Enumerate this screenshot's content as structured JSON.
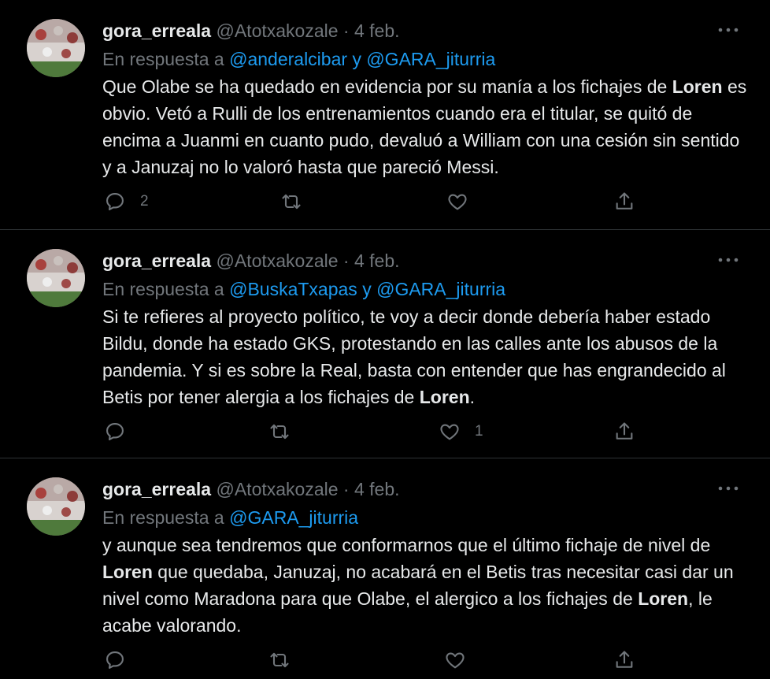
{
  "colors": {
    "background": "#000000",
    "text": "#e7e9ea",
    "secondary": "#71767b",
    "link": "#1d9bf0",
    "divider": "#2f3336"
  },
  "tweets": [
    {
      "display_name": "gora_erreala",
      "handle": "@Atotxakozale",
      "separator": "·",
      "date": "4 feb.",
      "reply_prefix": "En respuesta a",
      "reply_mentions": [
        "@anderalcibar",
        "@GARA_jiturria"
      ],
      "reply_conjunction": "y",
      "text": [
        {
          "t": "Que Olabe se ha quedado en evidencia por su manía a los fichajes de ",
          "b": false
        },
        {
          "t": "Loren",
          "b": true
        },
        {
          "t": " es obvio. Vetó a Rulli de los entrenamientos cuando era el titular, se quitó de encima a Juanmi en cuanto pudo, devaluó a William con una cesión sin sentido y a Januzaj no lo valoró hasta que pareció Messi.",
          "b": false
        }
      ],
      "reply_count": "2",
      "retweet_count": "",
      "like_count": ""
    },
    {
      "display_name": "gora_erreala",
      "handle": "@Atotxakozale",
      "separator": "·",
      "date": "4 feb.",
      "reply_prefix": "En respuesta a",
      "reply_mentions": [
        "@BuskaTxapas",
        "@GARA_jiturria"
      ],
      "reply_conjunction": "y",
      "text": [
        {
          "t": "Si te refieres al proyecto político, te voy a decir donde debería haber estado Bildu, donde ha estado GKS, protestando en las calles ante los abusos de la pandemia. Y si es sobre la Real, basta con entender que has engrandecido al Betis por tener alergia a los fichajes de ",
          "b": false
        },
        {
          "t": "Loren",
          "b": true
        },
        {
          "t": ".",
          "b": false
        }
      ],
      "reply_count": "",
      "retweet_count": "",
      "like_count": "1"
    },
    {
      "display_name": "gora_erreala",
      "handle": "@Atotxakozale",
      "separator": "·",
      "date": "4 feb.",
      "reply_prefix": "En respuesta a",
      "reply_mentions": [
        "@GARA_jiturria"
      ],
      "reply_conjunction": "",
      "text": [
        {
          "t": "y aunque sea tendremos que conformarnos que el último fichaje de nivel de ",
          "b": false
        },
        {
          "t": "Loren",
          "b": true
        },
        {
          "t": " que quedaba, Januzaj, no acabará en el Betis tras necesitar casi dar un nivel como Maradona para que Olabe, el alergico a los fichajes de ",
          "b": false
        },
        {
          "t": "Loren",
          "b": true
        },
        {
          "t": ", le acabe valorando.",
          "b": false
        }
      ],
      "reply_count": "",
      "retweet_count": "",
      "like_count": ""
    }
  ],
  "icons": {
    "more": "more-horizontal-icon",
    "reply": "reply-bubble-icon",
    "retweet": "retweet-icon",
    "like": "heart-icon",
    "share": "share-upload-icon"
  }
}
